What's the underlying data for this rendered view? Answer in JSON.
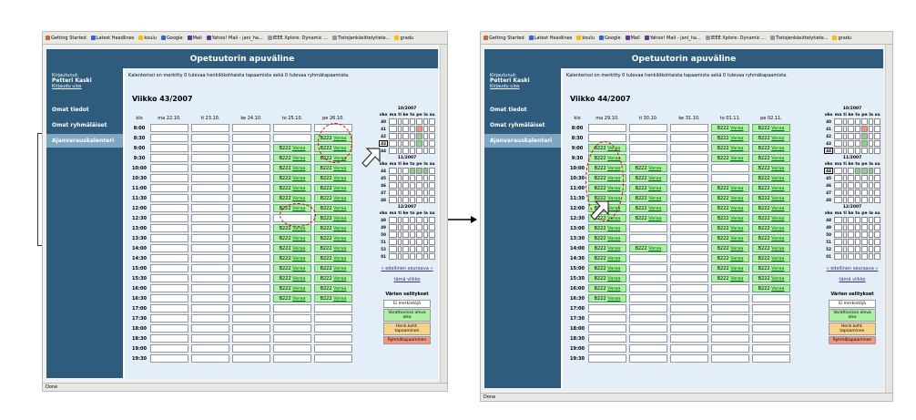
{
  "browser_bookmarks": [
    "Getting Started",
    "Latest Headlines",
    "koulu",
    "Google",
    "Mail",
    "Yahoo! Mail - jani_ha...",
    "IEEE Xplore: Dynamic ...",
    "Tietojenkäsittelytiete...",
    "gradu"
  ],
  "status_text": "Done",
  "app": {
    "title": "Opetuutorin apuväline",
    "login_label": "Kirjautunut:",
    "user_name": "Petteri Kaski",
    "logout": "Kirjaudu ulos",
    "nav": [
      "Omat tiedot",
      "Omat ryhmäläiset",
      "Ajanvarauskalenteri"
    ],
    "intro": "Kalenterissi on merkitty 0 tulevaa henkilökohtaista tapaamista sekä 0 tulevaa ryhmätapaamista.",
    "time_header": "klo",
    "times": [
      "8:00",
      "8:30",
      "9:00",
      "9:30",
      "10:00",
      "10:30",
      "11:00",
      "11:30",
      "12:00",
      "12:30",
      "13:00",
      "13:30",
      "14:00",
      "14:30",
      "15:00",
      "15:30",
      "16:00",
      "16:30",
      "17:00",
      "17:30",
      "18:00",
      "18:30",
      "19:00",
      "19:30"
    ],
    "booking_room": "B222",
    "booking_link": "Varaa",
    "prev": "« edellinen",
    "next": "seuraava »",
    "this_week": "tämä viikko",
    "legend_title": "Värien selitykset",
    "legend": [
      "Ei merkintöjä",
      "Varattavissa oleva aika",
      "Henk.koht. tapaaminen",
      "Ryhmätapaaminen"
    ],
    "legend_colors": [
      "#ffffff",
      "#adf0a6",
      "#f7d28a",
      "#f59580"
    ],
    "week_col": "vko",
    "dow": [
      "ma",
      "ti",
      "ke",
      "to",
      "pe",
      "la",
      "su"
    ]
  },
  "left": {
    "week_title": "Viikko 43/2007",
    "days": [
      "ma 22.10.",
      "ti 23.10.",
      "ke 24.10.",
      "to 25.10.",
      "pe 26.10."
    ],
    "months": [
      {
        "name": "10/2007",
        "weeks": [
          "40",
          "41",
          "42",
          "43",
          "44"
        ],
        "current": "43"
      },
      {
        "name": "11/2007",
        "weeks": [
          "44",
          "45",
          "46",
          "47",
          "48"
        ],
        "current": ""
      },
      {
        "name": "12/2007",
        "weeks": [
          "48",
          "49",
          "50",
          "51",
          "52",
          "01"
        ],
        "current": ""
      }
    ]
  },
  "right": {
    "week_title": "Viikko 44/2007",
    "days": [
      "ma 29.10.",
      "ti 30.10.",
      "ke 31.10.",
      "to 01.11.",
      "pe 02.11."
    ],
    "months": [
      {
        "name": "10/2007",
        "weeks": [
          "40",
          "41",
          "42",
          "43",
          "44"
        ],
        "current": "44"
      },
      {
        "name": "11/2007",
        "weeks": [
          "44",
          "45",
          "46",
          "47",
          "48"
        ],
        "current": "44"
      },
      {
        "name": "12/2007",
        "weeks": [
          "48",
          "49",
          "50",
          "51",
          "52",
          "01"
        ],
        "current": ""
      }
    ]
  }
}
